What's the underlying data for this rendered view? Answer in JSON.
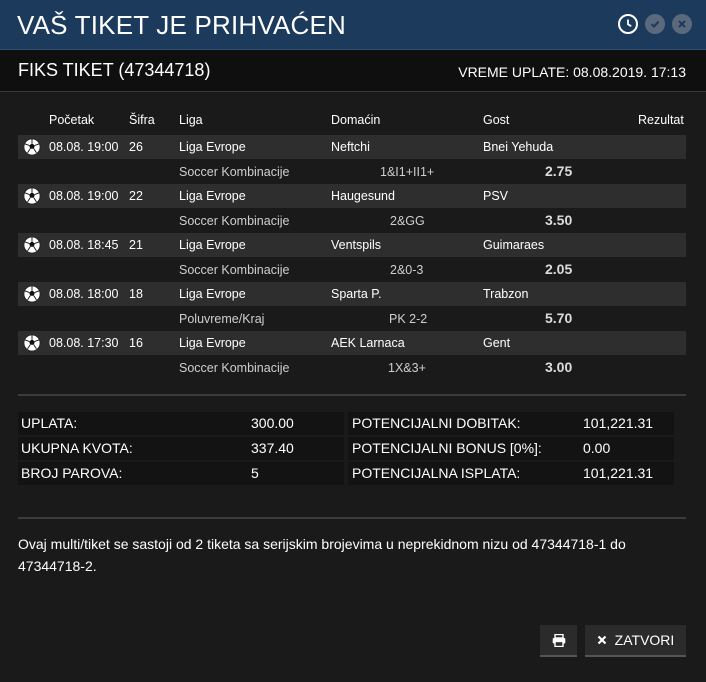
{
  "window": {
    "title": "VAŠ TIKET JE PRIHVAĆEN",
    "icons": [
      "clock-icon",
      "check-icon",
      "close-icon"
    ]
  },
  "ticket": {
    "name": "FIKS TIKET (47344718)",
    "pay_time": "VREME UPLATE: 08.08.2019. 17:13"
  },
  "table": {
    "headers": {
      "start": "Početak",
      "code": "Šifra",
      "league": "Liga",
      "home": "Domaćin",
      "away": "Gost",
      "result": "Rezultat"
    },
    "matches": [
      {
        "start": "08.08. 19:00",
        "code": "26",
        "league": "Liga Evrope",
        "home": "Neftchi",
        "away": "Bnei Yehuda",
        "market": "Soccer Kombinacije",
        "pick": "1&I1+II1+",
        "odds": "2.75"
      },
      {
        "start": "08.08. 19:00",
        "code": "22",
        "league": "Liga Evrope",
        "home": "Haugesund",
        "away": "PSV",
        "market": "Soccer Kombinacije",
        "pick": "2&GG",
        "odds": "3.50"
      },
      {
        "start": "08.08. 18:45",
        "code": "21",
        "league": "Liga Evrope",
        "home": "Ventspils",
        "away": "Guimaraes",
        "market": "Soccer Kombinacije",
        "pick": "2&0-3",
        "odds": "2.05"
      },
      {
        "start": "08.08. 18:00",
        "code": "18",
        "league": "Liga Evrope",
        "home": "Sparta P.",
        "away": "Trabzon",
        "market": "Poluvreme/Kraj",
        "pick": "PK 2-2",
        "odds": "5.70"
      },
      {
        "start": "08.08. 17:30",
        "code": "16",
        "league": "Liga Evrope",
        "home": "AEK Larnaca",
        "away": "Gent",
        "market": "Soccer Kombinacije",
        "pick": "1X&3+",
        "odds": "3.00"
      }
    ]
  },
  "summary": {
    "left": [
      {
        "label": "UPLATA:",
        "value": "300.00"
      },
      {
        "label": "UKUPNA KVOTA:",
        "value": "337.40"
      },
      {
        "label": "BROJ PAROVA:",
        "value": "5"
      }
    ],
    "right": [
      {
        "label": "POTENCIJALNI DOBITAK:",
        "value": "101,221.31"
      },
      {
        "label": "POTENCIJALNI BONUS [0%]:",
        "value": "0.00"
      },
      {
        "label": "POTENCIJALNA ISPLATA:",
        "value": "101,221.31"
      }
    ]
  },
  "note": "Ovaj multi/tiket se sastoji od 2 tiketa sa serijskim brojevima u neprekidnom nizu od 47344718-1 do 47344718-2.",
  "buttons": {
    "print_icon": "print-icon",
    "close_label": "ZATVORI",
    "close_icon": "times-icon"
  }
}
